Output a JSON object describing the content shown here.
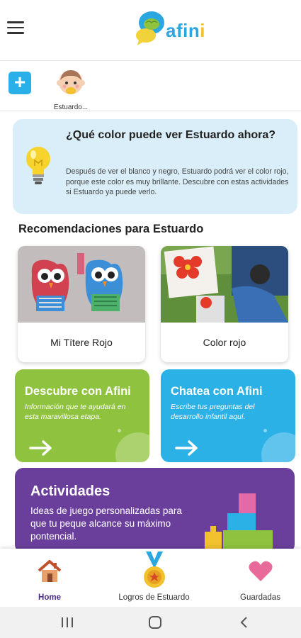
{
  "header": {
    "logo_text_a": "af",
    "logo_text_i1": "i",
    "logo_text_n": "n",
    "logo_text_i2": "i",
    "brand_color": "#2aa7e0",
    "brand_yellow": "#f2c12e"
  },
  "profiles": {
    "child_name": "Estuardo..."
  },
  "info_card": {
    "title": "¿Qué color puede ver Estuardo ahora?",
    "body": "Después de ver el blanco y negro, Estuardo podrá ver el color rojo, porque este color es muy brillante. Descubre con estas actividades si Estuardo ya puede verlo."
  },
  "recommendations": {
    "title": "Recomendaciones para Estuardo",
    "items": [
      {
        "label": "Mi Títere Rojo"
      },
      {
        "label": "Color rojo"
      }
    ]
  },
  "tiles": {
    "discover": {
      "title": "Descubre con Afini",
      "body": "Información que te ayudará en esta maravillosa etapa.",
      "color": "#8fc33f"
    },
    "chat": {
      "title": "Chatea con Afini",
      "body": "Escribe tus preguntas del desarrollo infantil aquí.",
      "color": "#2bb1e6"
    },
    "activities": {
      "title": "Actividades",
      "body": "Ideas de juego personalizadas para que tu peque alcance su máximo pontencial.",
      "color": "#6a3f9c"
    }
  },
  "bottom_nav": {
    "home": "Home",
    "achievements": "Logros de Estuardo",
    "saved": "Guardadas"
  }
}
